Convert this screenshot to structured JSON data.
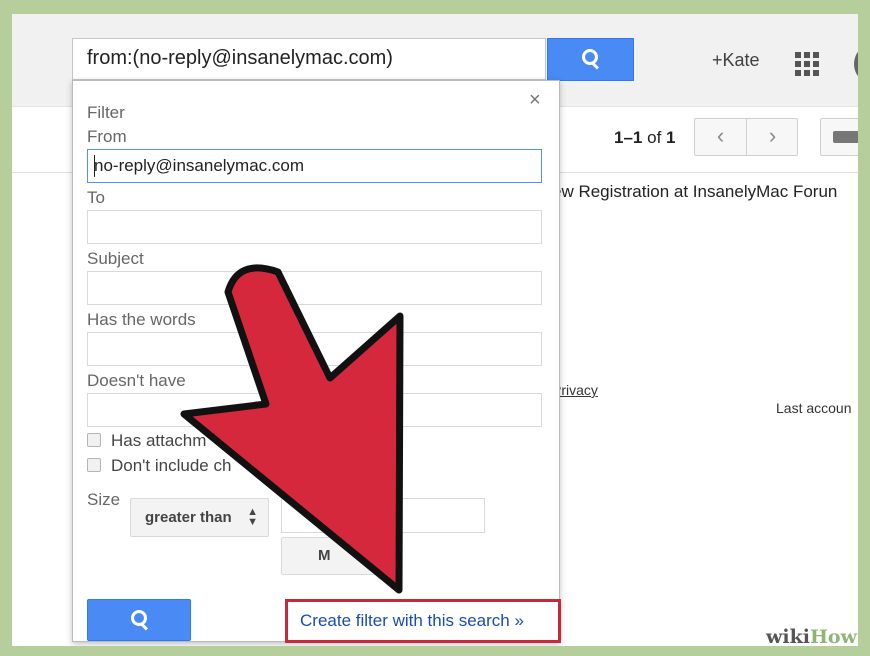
{
  "search": {
    "query": "from:(no-reply@insanelymac.com)"
  },
  "header": {
    "plus_user": "+Kate"
  },
  "toolbar": {
    "pagination_range": "1–1",
    "pagination_of": "of",
    "pagination_total": "1",
    "prev_glyph": "‹",
    "next_glyph": "›"
  },
  "mail": {
    "subject_fragment": "ew Registration at InsanelyMac Forun",
    "privacy_fragment": "Privacy",
    "last_account_fragment": "Last accoun"
  },
  "filter": {
    "title": "Filter",
    "close_glyph": "×",
    "from_label": "From",
    "from_value": "no-reply@insanelymac.com",
    "to_label": "To",
    "subject_label": "Subject",
    "has_words_label": "Has the words",
    "doesnt_have_label": "Doesn't have",
    "has_attachment_label": "Has attachm",
    "dont_include_label": "Don't include ch",
    "size_label": "Size",
    "size_operator": "greater than",
    "size_unit_fragment": "M",
    "create_filter_link": "Create filter with this search »"
  },
  "watermark": {
    "wiki": "wiki",
    "how": "How"
  },
  "colors": {
    "accent_blue": "#4a8af4",
    "highlight_red": "#c7283c",
    "arrow_red": "#d6283c",
    "frame_green": "#b5ce9c"
  },
  "icons": {
    "search": "magnifier-icon",
    "apps": "grid-icon",
    "keyboard": "keyboard-icon",
    "close": "close-icon"
  }
}
